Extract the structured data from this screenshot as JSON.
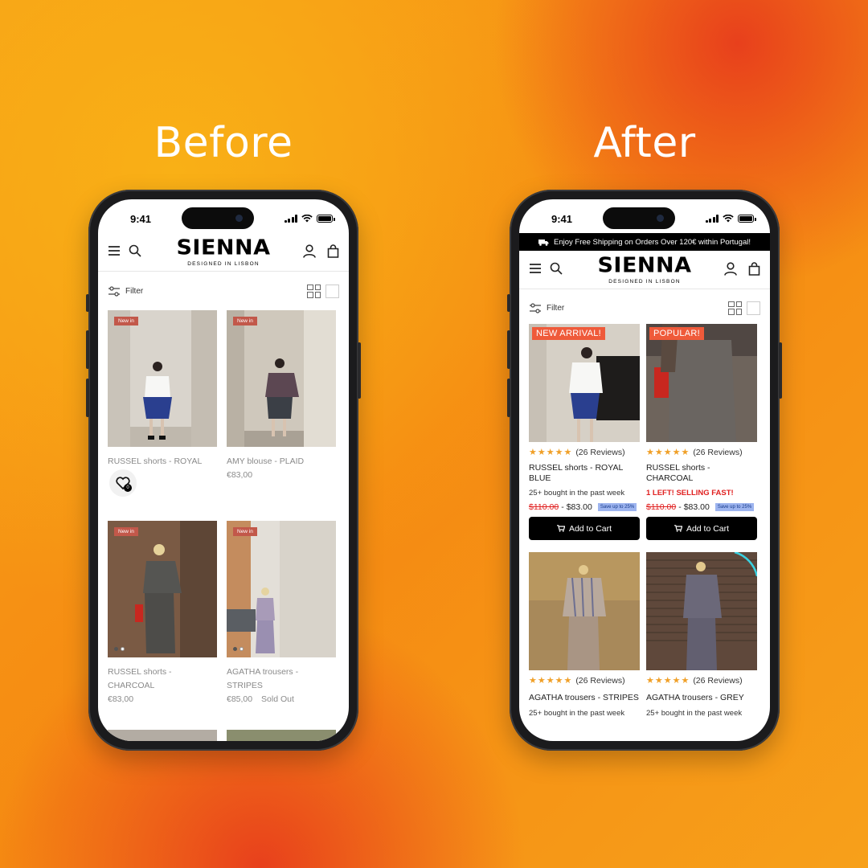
{
  "labels": {
    "before": "Before",
    "after": "After"
  },
  "status": {
    "time": "9:41"
  },
  "brand": {
    "name": "SIENNA",
    "tagline": "DESIGNED IN LISBON"
  },
  "banner": {
    "text": "Enjoy Free Shipping on Orders Over 120€ within Portugal!"
  },
  "filter": {
    "label": "Filter"
  },
  "before": {
    "badge": "New in",
    "wishlist_count": "0",
    "products": [
      {
        "title": "RUSSEL shorts - ROYAL",
        "price": "",
        "badge": "New in"
      },
      {
        "title": "AMY blouse - PLAID",
        "price": "€83,00",
        "badge": "New in"
      },
      {
        "title": "RUSSEL shorts - CHARCOAL",
        "price": "€83,00",
        "badge": "New in"
      },
      {
        "title": "AGATHA trousers - STRIPES",
        "price": "€85,00",
        "status": "Sold Out",
        "badge": "New in"
      }
    ]
  },
  "after": {
    "products": [
      {
        "badge": "NEW ARRIVAL!",
        "reviews": "(26 Reviews)",
        "title": "RUSSEL shorts - ROYAL BLUE",
        "sub": "25+ bought in the past week",
        "old_price": "$110.00",
        "sep": "-",
        "price": "$83.00",
        "save": "Save up to 25%",
        "cta": "Add to Cart"
      },
      {
        "badge": "POPULAR!",
        "reviews": "(26 Reviews)",
        "title": "RUSSEL shorts - CHARCOAL",
        "sub": "1 LEFT! SELLING FAST!",
        "old_price": "$110.00",
        "sep": "-",
        "price": "$83.00",
        "save": "Save up to 25%",
        "cta": "Add to Cart"
      },
      {
        "reviews": "(26 Reviews)",
        "title": "AGATHA trousers - STRIPES",
        "sub": "25+ bought in the past week"
      },
      {
        "reviews": "(26 Reviews)",
        "title": "AGATHA trousers - GREY",
        "sub": "25+ bought in the past week"
      }
    ],
    "stars": "★★★★★"
  },
  "colors": {
    "accent_orange": "#f58a12",
    "badge_red": "#ef5a3a",
    "alert_red": "#e02020",
    "save_blue": "#9db4ef"
  }
}
